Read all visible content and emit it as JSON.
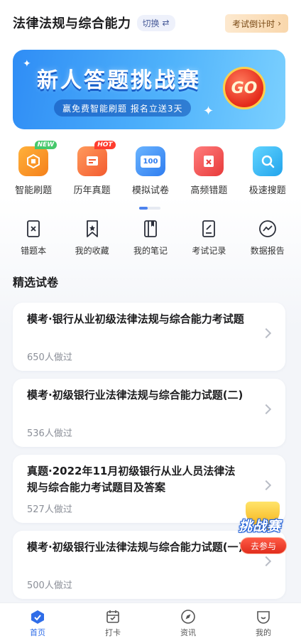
{
  "header": {
    "title": "法律法规与综合能力",
    "switch_label": "切换",
    "switch_icon": "swap-icon",
    "countdown_label": "考试倒计时"
  },
  "banner": {
    "title": "新人答题挑战赛",
    "subtitle": "赢免费智能刷题  报名立送3天",
    "go_label": "GO",
    "colors": {
      "start": "#2f8df5",
      "end": "#7bd0ff"
    }
  },
  "primary_features": [
    {
      "label": "智能刷题",
      "icon": "smart-practice-icon",
      "tag": "NEW",
      "color": "#f5901c"
    },
    {
      "label": "历年真题",
      "icon": "past-papers-icon",
      "tag": "HOT",
      "color": "#fa6a3a"
    },
    {
      "label": "模拟试卷",
      "icon": "mock-exam-icon",
      "icon_text": "100",
      "color": "#3b8cf2"
    },
    {
      "label": "高频错题",
      "icon": "frequent-errors-icon",
      "color": "#f04a4a"
    },
    {
      "label": "极速搜题",
      "icon": "quick-search-icon",
      "color": "#2fb4f0"
    }
  ],
  "secondary_features": [
    {
      "label": "错题本",
      "icon": "error-book-icon"
    },
    {
      "label": "我的收藏",
      "icon": "bookmark-icon"
    },
    {
      "label": "我的笔记",
      "icon": "notes-icon"
    },
    {
      "label": "考试记录",
      "icon": "exam-record-icon"
    },
    {
      "label": "数据报告",
      "icon": "data-report-icon"
    }
  ],
  "section_title": "精选试卷",
  "papers": [
    {
      "title": "模考·银行从业初级法律法规与综合能力考试题",
      "count": "650人做过"
    },
    {
      "title": "模考·初级银行业法律法规与综合能力试题(二)",
      "count": "536人做过"
    },
    {
      "title": "真题·2022年11月初级银行从业人员法律法规与综合能力考试题目及答案",
      "count": "527人做过"
    },
    {
      "title": "模考·初级银行业法律法规与综合能力试题(一)",
      "count": "500人做过"
    }
  ],
  "float_promo": {
    "word": "挑战赛",
    "button": "去参与"
  },
  "tabbar": [
    {
      "label": "首页",
      "icon": "home-icon",
      "active": true
    },
    {
      "label": "打卡",
      "icon": "calendar-icon",
      "active": false
    },
    {
      "label": "资讯",
      "icon": "compass-icon",
      "active": false
    },
    {
      "label": "我的",
      "icon": "profile-icon",
      "active": false
    }
  ],
  "colors": {
    "accent": "#2f6de8",
    "background": "#f3f5f9"
  }
}
